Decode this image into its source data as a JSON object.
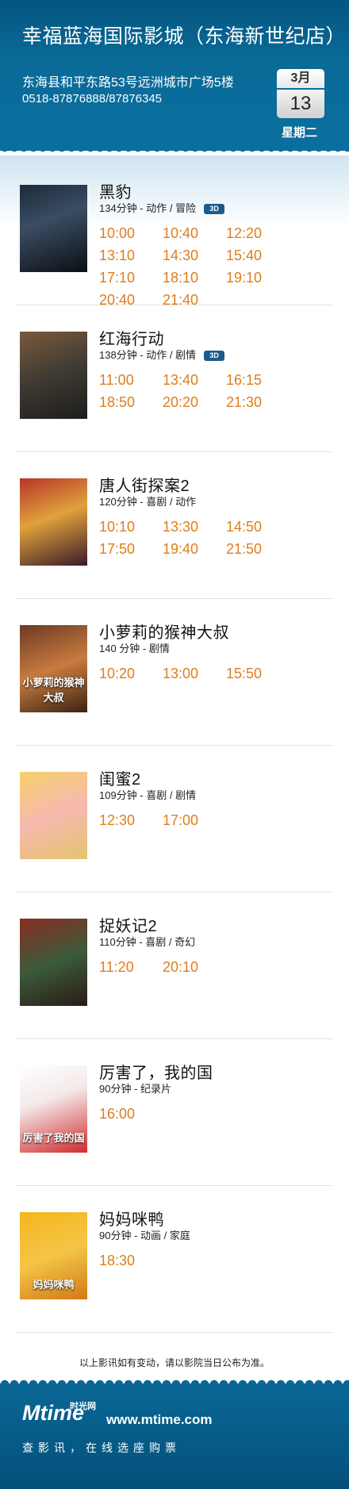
{
  "cinema": {
    "name": "幸福蓝海国际影城（东海新世纪店）",
    "address": "东海县和平东路53号远洲城市广场5楼",
    "phone": "0518-87876888/87876345"
  },
  "date": {
    "month": "3月",
    "day": "13",
    "weekday": "星期二"
  },
  "movies": [
    {
      "title": "黑豹",
      "info": "134分钟 - 动作 / 冒险",
      "badge": "3D",
      "times": [
        "10:00",
        "10:40",
        "12:20",
        "13:10",
        "14:30",
        "15:40",
        "17:10",
        "18:10",
        "19:10",
        "20:40",
        "21:40"
      ]
    },
    {
      "title": "红海行动",
      "info": "138分钟 - 动作 / 剧情",
      "badge": "3D",
      "times": [
        "11:00",
        "13:40",
        "16:15",
        "18:50",
        "20:20",
        "21:30"
      ]
    },
    {
      "title": "唐人街探案2",
      "info": "120分钟 - 喜剧 / 动作",
      "times": [
        "10:10",
        "13:30",
        "14:50",
        "17:50",
        "19:40",
        "21:50"
      ]
    },
    {
      "title": "小萝莉的猴神大叔",
      "info": "140 分钟 - 剧情",
      "poster_text": "小萝莉的猴神大叔",
      "times": [
        "10:20",
        "13:00",
        "15:50"
      ]
    },
    {
      "title": "闺蜜2",
      "info": "109分钟 - 喜剧 / 剧情",
      "times": [
        "12:30",
        "17:00"
      ]
    },
    {
      "title": "捉妖记2",
      "info": "110分钟 - 喜剧 / 奇幻",
      "times": [
        "11:20",
        "20:10"
      ]
    },
    {
      "title": "厉害了，我的国",
      "info": "90分钟 - 纪录片",
      "poster_text": "厉害了我的国",
      "times": [
        "16:00"
      ]
    },
    {
      "title": "妈妈咪鸭",
      "info": "90分钟 - 动画 / 家庭",
      "poster_text": "妈妈咪鸭",
      "times": [
        "18:30"
      ]
    }
  ],
  "notice": "以上影讯如有变动，请以影院当日公布为准。",
  "footer": {
    "logo": "Mtime",
    "logo_cn": "时光网",
    "url": "www.mtime.com",
    "slogan": "查影讯，在线选座购票"
  },
  "colors": {
    "header_blue": "#0a6a98",
    "time_orange": "#e07d1a",
    "badge_blue": "#1d5a8a"
  },
  "icons": {
    "calendar": "calendar-icon",
    "badge3d": "3d-badge-icon"
  }
}
